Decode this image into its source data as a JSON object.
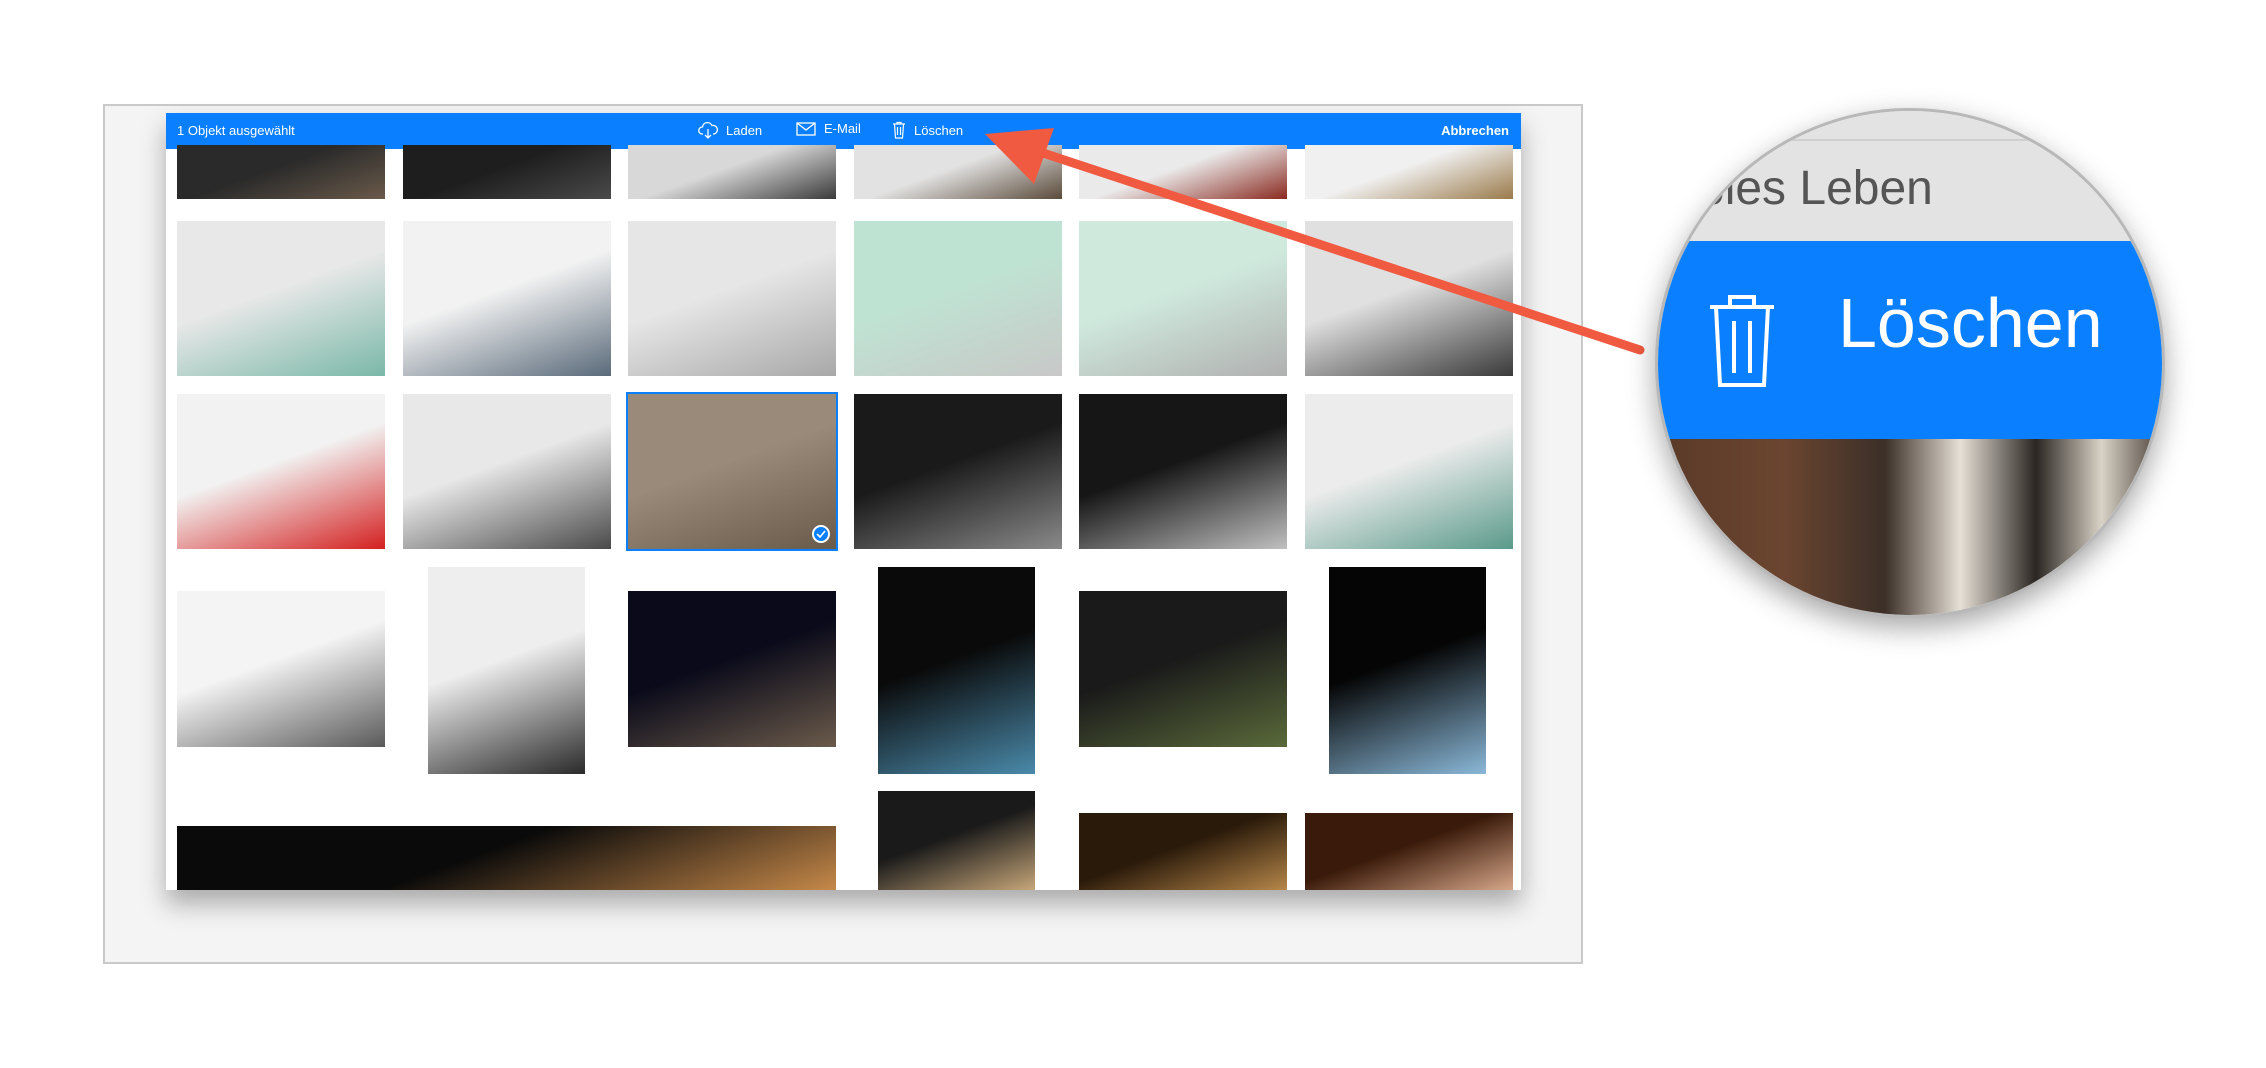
{
  "toolbar": {
    "selection_text": "1 Objekt ausgewählt",
    "download_label": "Laden",
    "email_label": "E-Mail",
    "delete_label": "Löschen",
    "cancel_label": "Abbrechen",
    "icons": [
      "download-icon",
      "email-icon",
      "trash-icon"
    ]
  },
  "photos": [
    {
      "name": "photo-crowd-1",
      "colors": [
        "#2a2a2a",
        "#6a5a4a"
      ]
    },
    {
      "name": "photo-crowd-2",
      "colors": [
        "#1e1e1e",
        "#4a4a4a"
      ]
    },
    {
      "name": "photo-museum-crowd",
      "colors": [
        "#d8d8d8",
        "#3a3a3a"
      ]
    },
    {
      "name": "photo-museum-people",
      "colors": [
        "#e2e2e2",
        "#5a4a3a"
      ]
    },
    {
      "name": "photo-red-car-partial",
      "colors": [
        "#eaeaea",
        "#8a2a20"
      ]
    },
    {
      "name": "photo-carriage",
      "colors": [
        "#f0f0f0",
        "#9a7a4a"
      ]
    },
    {
      "name": "photo-museum-hall",
      "colors": [
        "#e8e8e8",
        "#7ab8a8"
      ]
    },
    {
      "name": "photo-escalator-view",
      "colors": [
        "#f2f2f2",
        "#5a6a7a"
      ]
    },
    {
      "name": "photo-silver-roadster",
      "colors": [
        "#e6e6e6",
        "#a8a8a8"
      ]
    },
    {
      "name": "photo-racecar-1947",
      "colors": [
        "#bfe3d3",
        "#c8c8c8"
      ]
    },
    {
      "name": "photo-356-roadster",
      "colors": [
        "#cfe9dd",
        "#b0b0b0"
      ]
    },
    {
      "name": "photo-silver-coupe",
      "colors": [
        "#e0e0e0",
        "#3a3a3a"
      ]
    },
    {
      "name": "photo-red-interior",
      "colors": [
        "#f2f2f2",
        "#d42020"
      ]
    },
    {
      "name": "photo-white-racecars",
      "colors": [
        "#e8e8e8",
        "#4a4a4a"
      ]
    },
    {
      "name": "photo-window-cars",
      "colors": [
        "#9a8a7a",
        "#6a5a4a"
      ]
    },
    {
      "name": "photo-boxster-dark",
      "colors": [
        "#1a1a1a",
        "#8a8a8a"
      ]
    },
    {
      "name": "photo-gt1-silver",
      "colors": [
        "#161616",
        "#c0c0c0"
      ]
    },
    {
      "name": "photo-museum-floor",
      "colors": [
        "#ececec",
        "#5a9a8a"
      ]
    },
    {
      "name": "photo-racecar-ramp",
      "colors": [
        "#f4f4f4",
        "#5a5a5a"
      ]
    },
    {
      "name": "photo-escalator",
      "colors": [
        "#eeeeee",
        "#2a2a2a"
      ]
    },
    {
      "name": "photo-night-people",
      "colors": [
        "#0a0a1a",
        "#6a5a4a"
      ]
    },
    {
      "name": "photo-christmas-tree-1",
      "colors": [
        "#0a0a0a",
        "#4a8aaa"
      ]
    },
    {
      "name": "photo-model-railway",
      "colors": [
        "#1a1a1a",
        "#5a6a3a"
      ]
    },
    {
      "name": "photo-christmas-tree-2",
      "colors": [
        "#050505",
        "#8ab8d8"
      ]
    },
    {
      "name": "photo-night-panorama",
      "colors": [
        "#0a0a0a",
        "#c88a4a"
      ]
    },
    {
      "name": "photo-beer-glass",
      "colors": [
        "#1a1a1a",
        "#c8a87a"
      ]
    },
    {
      "name": "photo-restaurant",
      "colors": [
        "#2a1a0a",
        "#b8884a"
      ]
    },
    {
      "name": "photo-table",
      "colors": [
        "#3a1a0a",
        "#d8a88a"
      ]
    }
  ],
  "selected_photo": "photo-window-cars",
  "magnifier": {
    "top_label": "bles Leben",
    "label": "Löschen",
    "icon": "trash-icon"
  },
  "colors": {
    "accent": "#0a7fff",
    "arrow": "#f05a40"
  }
}
